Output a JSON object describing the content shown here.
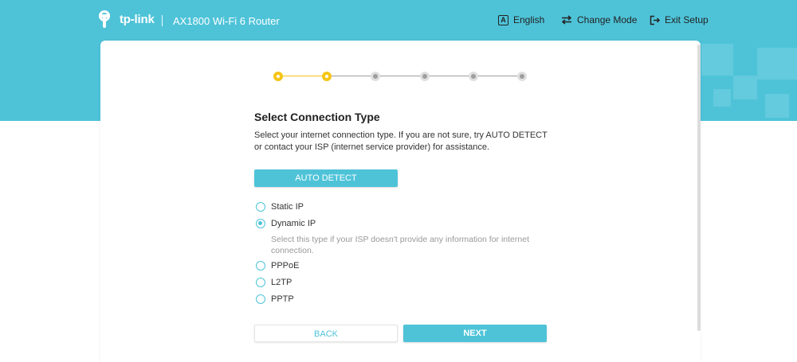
{
  "header": {
    "brand": "tp-link",
    "model": "AX1800 Wi-Fi 6 Router",
    "language_label": "English",
    "language_icon": "A",
    "change_mode_label": "Change Mode",
    "exit_setup_label": "Exit Setup"
  },
  "colors": {
    "accent": "#4ec3d8",
    "step_active": "#f5c518",
    "step_pending": "#9e9e9e"
  },
  "stepper": {
    "total_steps": 6,
    "current_step": 2
  },
  "page": {
    "title": "Select Connection Type",
    "description": "Select your internet connection type. If you are not sure, try AUTO DETECT or contact your ISP (internet service provider) for assistance."
  },
  "auto_detect_label": "AUTO DETECT",
  "connection_types": [
    {
      "label": "Static IP",
      "selected": false
    },
    {
      "label": "Dynamic IP",
      "selected": true
    },
    {
      "label": "PPPoE",
      "selected": false
    },
    {
      "label": "L2TP",
      "selected": false
    },
    {
      "label": "PPTP",
      "selected": false
    }
  ],
  "dynamic_hint": "Select this type if your ISP doesn't provide any information for internet connection.",
  "buttons": {
    "back_label": "BACK",
    "next_label": "NEXT"
  }
}
